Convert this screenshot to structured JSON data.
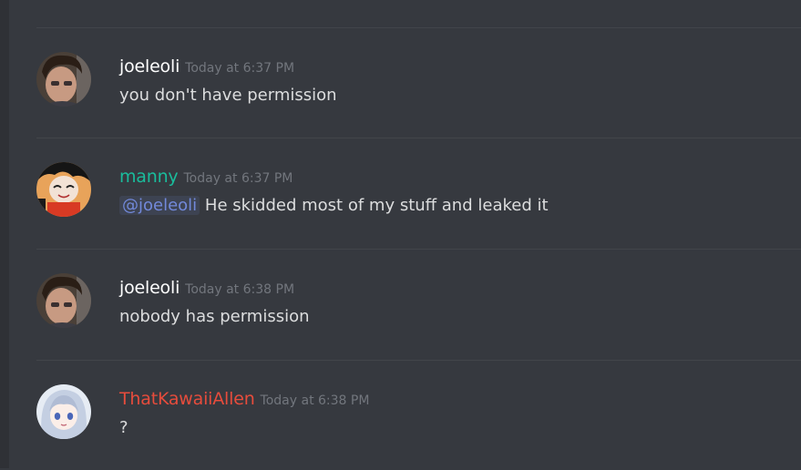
{
  "colors": {
    "background": "#36393f",
    "divider": "#42454a",
    "timestamp": "#72767d",
    "text": "#dcddde",
    "mention": "#7289da"
  },
  "messages": [
    {
      "username": "joeleoli",
      "username_color": "#ffffff",
      "timestamp": "Today at 6:37 PM",
      "text": "you don't have permission",
      "avatar": "joeleoli-avatar"
    },
    {
      "username": "manny",
      "username_color": "#1abc9c",
      "timestamp": "Today at 6:37 PM",
      "mention": "@joeleoli",
      "text": "He skidded most of my stuff and leaked it",
      "avatar": "manny-avatar"
    },
    {
      "username": "joeleoli",
      "username_color": "#ffffff",
      "timestamp": "Today at 6:38 PM",
      "text": "nobody has permission",
      "avatar": "joeleoli-avatar"
    },
    {
      "username": "ThatKawaiiAllen",
      "username_color": "#e74c3c",
      "timestamp": "Today at 6:38 PM",
      "text": "?",
      "avatar": "thatkawaiiallen-avatar"
    }
  ]
}
